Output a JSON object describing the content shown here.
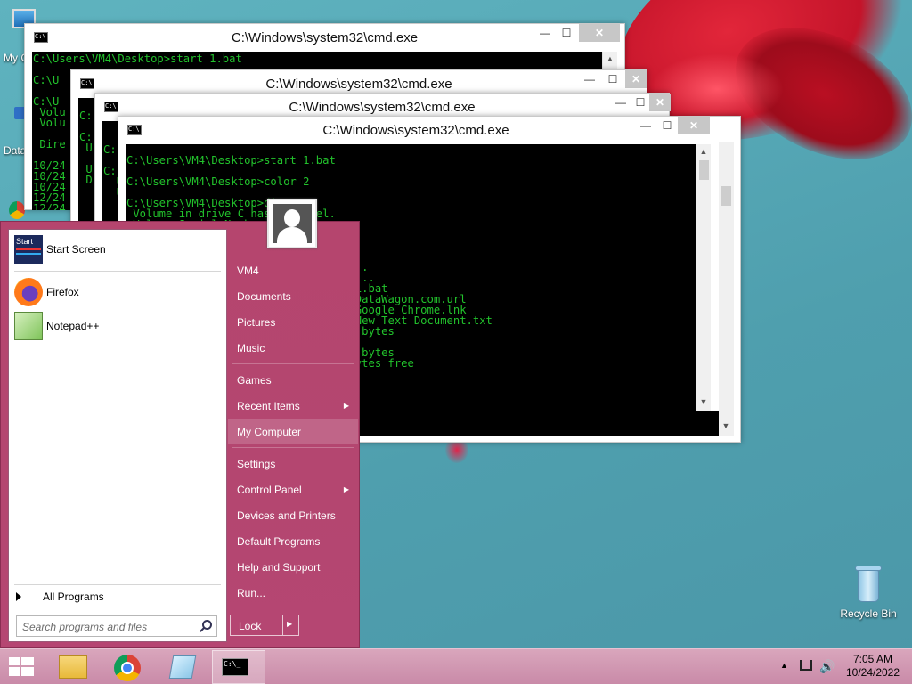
{
  "desktop": {
    "icons": [
      {
        "label": "My C"
      },
      {
        "label": "Data"
      },
      {
        "label": "Recycle Bin"
      }
    ]
  },
  "windows": [
    {
      "title": "C:\\Windows\\system32\\cmd.exe",
      "console": "C:\\Users\\VM4\\Desktop>start 1.bat\n\nC:\\U\n\nC:\\U\n Volu\n Volu\n\n Dire\n\n10/24\n10/24\n10/24\n12/24\n12/24"
    },
    {
      "title": "C:\\Windows\\system32\\cmd.exe",
      "console": "\nC:\n\nC:\n U\n\n U\n D"
    },
    {
      "title": "C:\\Windows\\system32\\cmd.exe",
      "console": "\n\nC:\n\nC:\n  U\n  U"
    },
    {
      "title": "C:\\Windows\\system32\\cmd.exe",
      "console": "C:\\Users\\VM4\\Desktop>start 1.bat\n\nC:\\Users\\VM4\\Desktop>color 2\n\nC:\\Users\\VM4\\Desktop>dir\n Volume in drive C has no label.\n Volume Serial Number is 5\n\n Directory of C:\\Users\\VM4\\Desktop\n\n                                    .\n                                    ..\n                                27 1.bat\n                               105 DataWagon.com.url\n                             2,225 Google Chrome.lnk\n                                 0 New Text Document.txt\n                              2,357 bytes\n\n                              2,357 bytes\n                           77,600 bytes free"
    }
  ],
  "start_menu": {
    "pinned": [
      {
        "label": "Start Screen",
        "icon": "start-screen-icon"
      },
      {
        "label": "Firefox",
        "icon": "firefox-icon"
      },
      {
        "label": "Notepad++",
        "icon": "notepad-plus-plus-icon"
      }
    ],
    "all_programs": "All Programs",
    "search_placeholder": "Search programs and files",
    "right_items": [
      {
        "label": "VM4"
      },
      {
        "label": "Documents"
      },
      {
        "label": "Pictures"
      },
      {
        "label": "Music"
      },
      {
        "label": "Games"
      },
      {
        "label": "Recent Items"
      },
      {
        "label": "My Computer"
      },
      {
        "label": "Settings"
      },
      {
        "label": "Control Panel"
      },
      {
        "label": "Devices and Printers"
      },
      {
        "label": "Default Programs"
      },
      {
        "label": "Help and Support"
      },
      {
        "label": "Run..."
      }
    ],
    "lock_label": "Lock"
  },
  "taskbar": {
    "apps": [
      "file-explorer-icon",
      "chrome-icon",
      "notepad-icon",
      "cmd-icon"
    ],
    "time": "7:05 AM",
    "date": "10/24/2022"
  },
  "colors": {
    "console_text": "#22c22c",
    "start_menu_bg": "#b5456e"
  }
}
